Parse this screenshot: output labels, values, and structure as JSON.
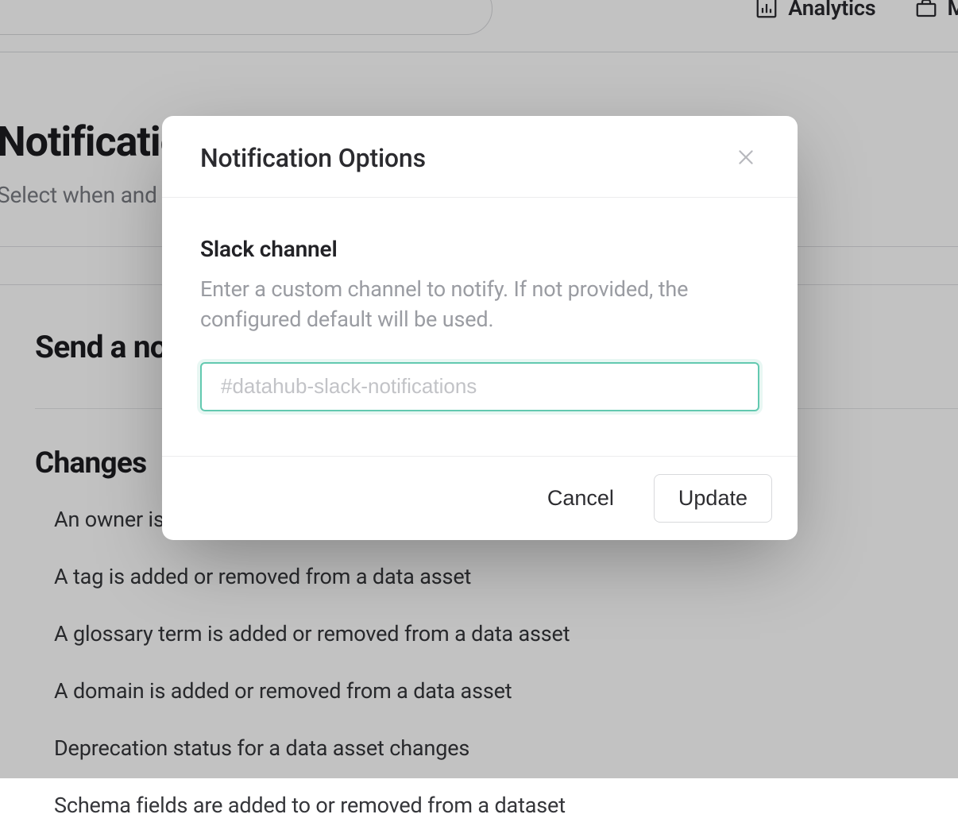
{
  "topnav": {
    "analytics_label": "Analytics",
    "second_label_first_char": "M"
  },
  "page": {
    "title_visible_fragment": "Notificatio",
    "subtitle_visible_fragment": "Select when and w"
  },
  "section_send": {
    "title_visible_fragment": "Send a no"
  },
  "section_changes": {
    "title": "Changes",
    "items": [
      "An owner is a",
      "A tag is added or removed from a data asset",
      "A glossary term is added or removed from a data asset",
      "A domain is added or removed from a data asset",
      "Deprecation status for a data asset changes",
      "Schema fields are added to or removed from a dataset"
    ]
  },
  "modal": {
    "title": "Notification Options",
    "slack_label": "Slack channel",
    "slack_help": "Enter a custom channel to notify. If not provided, the configured default will be used.",
    "slack_placeholder": "#datahub-slack-notifications",
    "cancel": "Cancel",
    "update": "Update"
  }
}
